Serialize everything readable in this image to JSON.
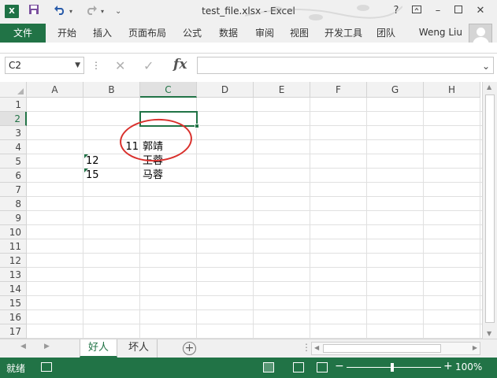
{
  "window": {
    "title": "test_file.xlsx - Excel",
    "app_icon": "X",
    "help": "?"
  },
  "ribbon": {
    "tabs": [
      "文件",
      "开始",
      "插入",
      "页面布局",
      "公式",
      "数据",
      "审阅",
      "视图",
      "开发工具",
      "团队"
    ],
    "user": "Weng Liu"
  },
  "formula_bar": {
    "name_box": "C2",
    "fx": "fx",
    "value": ""
  },
  "grid": {
    "columns": [
      "A",
      "B",
      "C",
      "D",
      "E",
      "F",
      "G",
      "H"
    ],
    "rows": [
      "1",
      "2",
      "3",
      "4",
      "5",
      "6",
      "7",
      "8",
      "9",
      "10",
      "11",
      "12",
      "13",
      "14",
      "15",
      "16",
      "17"
    ],
    "selected_cell": "C2",
    "cells": {
      "C4_num": "11",
      "C4_text": "郭靖",
      "B5": "12",
      "C5": "王蓉",
      "B6": "15",
      "C6": "马蓉"
    }
  },
  "sheets": {
    "tabs": [
      "好人",
      "坏人"
    ],
    "active": "好人",
    "add": "⊕"
  },
  "status": {
    "ready": "就绪",
    "zoom": "100%",
    "zoom_minus": "−",
    "zoom_plus": "+"
  },
  "colors": {
    "excel_green": "#217346",
    "annotation_red": "#d9302c"
  }
}
